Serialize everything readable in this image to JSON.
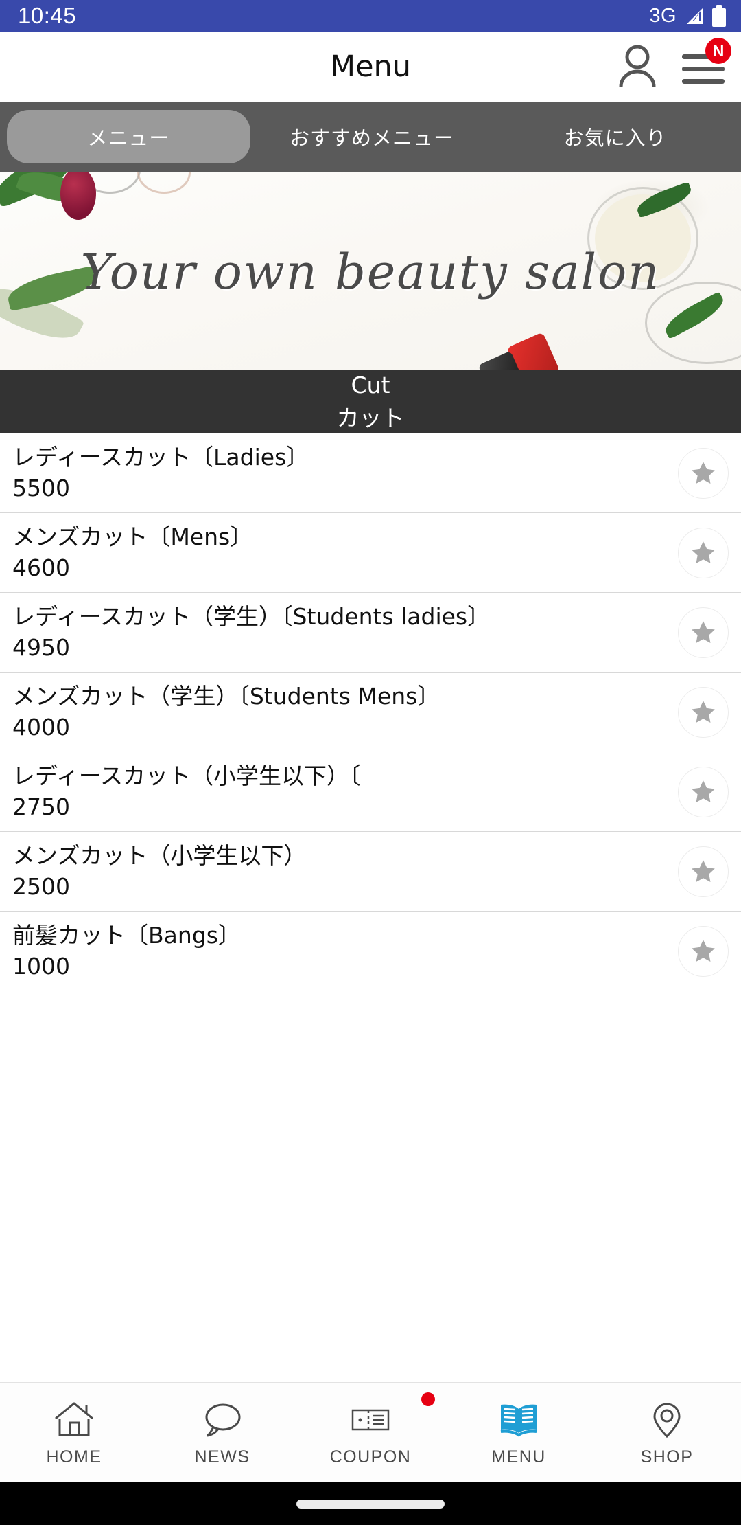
{
  "status_bar": {
    "clock": "10:45",
    "network": "3G",
    "signal_icon": "signal-triangle-icon",
    "battery_icon": "battery-full-icon",
    "background_color": "#3949ab"
  },
  "app_bar": {
    "title": "Menu",
    "account_icon": "person-icon",
    "menu_icon": "hamburger-icon",
    "notification_badge": "N",
    "badge_color": "#e60012"
  },
  "tabs": {
    "items": [
      {
        "label": "メニュー",
        "active": true
      },
      {
        "label": "おすすめメニュー",
        "active": false
      },
      {
        "label": "お気に入り",
        "active": false
      }
    ],
    "bar_color": "#5a5a5a",
    "active_pill_color": "#9a9a9a"
  },
  "banner": {
    "headline": "Your own beauty salon",
    "alt": "beauty salon products flat lay with olive leaves, glass jar and red bottle"
  },
  "section": {
    "title_en": "Cut",
    "title_jp": "カット",
    "background_color": "#333333"
  },
  "menu_items": [
    {
      "name": "レディースカット〔Ladies〕",
      "price": "5500",
      "favorite_icon": "star-icon"
    },
    {
      "name": "メンズカット〔Mens〕",
      "price": "4600",
      "favorite_icon": "star-icon"
    },
    {
      "name": "レディースカット（学生）〔Students ladies〕",
      "price": "4950",
      "favorite_icon": "star-icon"
    },
    {
      "name": "メンズカット（学生）〔Students Mens〕",
      "price": "4000",
      "favorite_icon": "star-icon"
    },
    {
      "name": "レディースカット（小学生以下）〔",
      "price": "2750",
      "favorite_icon": "star-icon"
    },
    {
      "name": "メンズカット（小学生以下）",
      "price": "2500",
      "favorite_icon": "star-icon"
    },
    {
      "name": "前髪カット〔Bangs〕",
      "price": "1000",
      "favorite_icon": "star-icon"
    }
  ],
  "bottom_nav": {
    "active_color": "#1f9ed4",
    "inactive_color": "#4a4a4a",
    "items": [
      {
        "label": "HOME",
        "icon": "home-icon",
        "active": false,
        "dot": false
      },
      {
        "label": "NEWS",
        "icon": "chat-bubble-icon",
        "active": false,
        "dot": false
      },
      {
        "label": "COUPON",
        "icon": "ticket-icon",
        "active": false,
        "dot": true
      },
      {
        "label": "MENU",
        "icon": "open-book-icon",
        "active": true,
        "dot": false
      },
      {
        "label": "SHOP",
        "icon": "map-pin-icon",
        "active": false,
        "dot": false
      }
    ]
  }
}
